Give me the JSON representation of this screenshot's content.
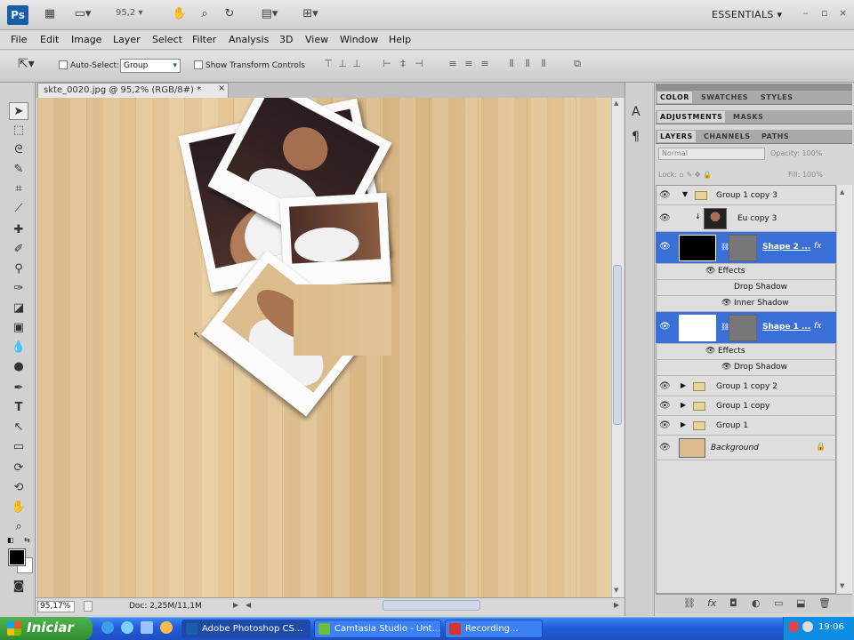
{
  "app": {
    "logo": "Ps",
    "zoom_value": "95,2",
    "workspace": "ESSENTIALS",
    "window_controls": [
      "–",
      "▫",
      "×"
    ]
  },
  "menu": [
    "File",
    "Edit",
    "Image",
    "Layer",
    "Select",
    "Filter",
    "Analysis",
    "3D",
    "View",
    "Window",
    "Help"
  ],
  "options": {
    "auto_select_label": "Auto-Select:",
    "auto_select_value": "Group",
    "show_transform_label": "Show Transform Controls"
  },
  "document": {
    "tab_title": "skte_0020.jpg @ 95,2% (RGB/8#) *",
    "zoom_status": "95,17%",
    "doc_status": "Doc: 2,25M/11,1M"
  },
  "panels": {
    "row1_tabs": [
      "COLOR",
      "SWATCHES",
      "STYLES"
    ],
    "row2_tabs": [
      "ADJUSTMENTS",
      "MASKS"
    ],
    "row3_tabs": [
      "LAYERS",
      "CHANNELS",
      "PATHS"
    ],
    "blend_mode": "Normal",
    "opacity_label": "Opacity:",
    "opacity_value": "100%",
    "lock_label": "Lock:",
    "fill_label": "Fill:",
    "fill_value": "100%"
  },
  "layers": [
    {
      "name": "Group 1 copy 3",
      "kind": "group-open"
    },
    {
      "name": "Eu copy 3",
      "kind": "image"
    },
    {
      "name": "Shape 2 ...",
      "kind": "shape-selected"
    },
    {
      "name": "Effects",
      "kind": "effects"
    },
    {
      "name": "Drop Shadow",
      "kind": "effect"
    },
    {
      "name": "Inner Shadow",
      "kind": "effect-eye"
    },
    {
      "name": "Shape 1 ...",
      "kind": "shape-selected"
    },
    {
      "name": "Effects",
      "kind": "effects"
    },
    {
      "name": "Drop Shadow",
      "kind": "effect-eye"
    },
    {
      "name": "Group 1 copy 2",
      "kind": "group"
    },
    {
      "name": "Group 1 copy",
      "kind": "group"
    },
    {
      "name": "Group 1",
      "kind": "group"
    },
    {
      "name": "Background",
      "kind": "background"
    }
  ],
  "taskbar": {
    "start_label": "Iniciar",
    "buttons": [
      "Adobe Photoshop CS...",
      "Camtasia Studio - Unt...",
      "Recording..."
    ],
    "clock": "19:06"
  },
  "colors": {
    "selection_blue": "#3a6fd8",
    "taskbar_blue": "#245edb",
    "start_green": "#2f8d2f",
    "wood": "#dcbc8c"
  }
}
